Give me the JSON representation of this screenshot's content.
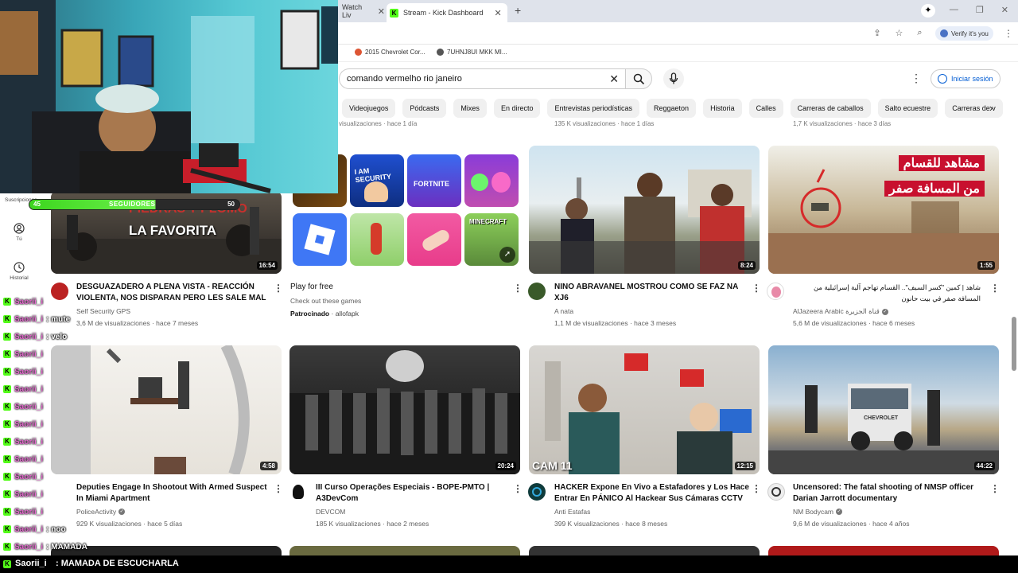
{
  "browser": {
    "tabs": [
      {
        "label": "Watch Liv",
        "icon": "generic-tab-icon"
      },
      {
        "label": "Stream - Kick Dashboard",
        "icon": "kick-icon"
      }
    ],
    "verify_label": "Verify it's you",
    "bookmarks": [
      "2015 Chevrolet Cor...",
      "7UHNJ8UI MKK MI..."
    ]
  },
  "youtube": {
    "search_value": "comando vermelho rio janeiro",
    "signin_label": "Iniciar sesión",
    "chips": [
      "Videojuegos",
      "Pódcasts",
      "Mixes",
      "En directo",
      "Entrevistas periodísticas",
      "Reggaeton",
      "Historia",
      "Calles",
      "Carreras de caballos",
      "Salto ecuestre",
      "Carreras de v"
    ],
    "prev_row_meta": [
      "visualizaciones · hace 1 día",
      "135 K visualizaciones · hace 1 días",
      "1,7 K visualizaciones · hace 3 días"
    ],
    "sidebar": [
      {
        "label": "Suscripciones",
        "icon": "subscriptions-icon"
      },
      {
        "label": "Tú",
        "icon": "account-icon"
      },
      {
        "label": "Historial",
        "icon": "history-icon"
      }
    ],
    "videos": [
      {
        "title": "DESGUAZADERO A PLENA VISTA - REACCIÓN VIOLENTA, NOS DISPARAN PERO LES SALE MAL",
        "channel": "Self Security GPS",
        "stats": "3,6 M de visualizaciones · hace 7 meses",
        "duration": "16:54",
        "thumb_text": "LA FAVORITA",
        "thumb_text2": "PIEDRAS Y PLOMO"
      },
      {
        "title": "Play for free",
        "subtitle": "Check out these games",
        "sponsored": "Patrocinado",
        "advertiser": "allofapk"
      },
      {
        "title": "NINO ABRAVANEL MOSTROU COMO SE FAZ NA XJ6",
        "channel": "A nata",
        "stats": "1,1 M de visualizaciones · hace 3 meses",
        "duration": "8:24"
      },
      {
        "title": "شاهد | كمين \"كسر السيف\".. القسام تهاجم آلية إسرائيلية من المسافة صفر في بيت حانون",
        "channel": "AlJazeera Arabic قناة الجزيرة",
        "stats": "5,6 M de visualizaciones · hace 6 meses",
        "duration": "1:55",
        "thumb_text": "مشاهد للقسام",
        "thumb_text2": "من المسافة صفر"
      },
      {
        "title": "Deputies Engage In Shootout With Armed Suspect In Miami Apartment",
        "channel": "PoliceActivity",
        "stats": "929 K visualizaciones · hace 5 días",
        "duration": "4:58"
      },
      {
        "title": "III Curso Operações Especiais - BOPE-PMTO | A3DevCom",
        "channel": "DEVCOM",
        "stats": "185 K visualizaciones · hace 2 meses",
        "duration": "20:24"
      },
      {
        "title": "HACKER Expone En Vivo a Estafadores y Los Hace Entrar En PÁNICO Al Hackear Sus Cámaras CCTV",
        "channel": "Anti Estafas",
        "stats": "399 K visualizaciones · hace 8 meses",
        "duration": "12:15",
        "thumb_text": "CAM 11"
      },
      {
        "title": "Uncensored: The fatal shooting of NMSP officer Darian Jarrott documentary",
        "channel": "NM Bodycam",
        "stats": "9,6 M de visualizaciones · hace 4 años",
        "duration": "44:22",
        "thumb_text": "CHEVROLET"
      }
    ],
    "game_tiles": [
      "I AM SECURITY",
      "FORTNITE",
      "",
      "",
      "",
      "",
      "",
      "MINECRAFT"
    ]
  },
  "stream_overlay": {
    "followers_left": "45",
    "followers_label": "SEGUIDORES",
    "followers_right": "50",
    "chat": [
      {
        "user": "Saorii_i",
        "msg": ": mute"
      },
      {
        "user": "Saorii_i",
        "msg": ": velo"
      },
      {
        "user": "Saorii_i",
        "msg": ""
      },
      {
        "user": "Saorii_i",
        "msg": ""
      },
      {
        "user": "Saorii_i",
        "msg": ""
      },
      {
        "user": "Saorii_i",
        "msg": ""
      },
      {
        "user": "Saorii_i",
        "msg": ""
      },
      {
        "user": "Saorii_i",
        "msg": ""
      },
      {
        "user": "Saorii_i",
        "msg": ""
      },
      {
        "user": "Saorii_i",
        "msg": ""
      },
      {
        "user": "Saorii_i",
        "msg": ""
      },
      {
        "user": "Saorii_i",
        "msg": ""
      },
      {
        "user": "Saorii_i",
        "msg": ": noo"
      },
      {
        "user": "Saorii_i",
        "msg": ": MAMADA"
      }
    ],
    "bottom_user": "Saorii_i",
    "bottom_msg": ": MAMADA DE ESCUCHARLA"
  }
}
